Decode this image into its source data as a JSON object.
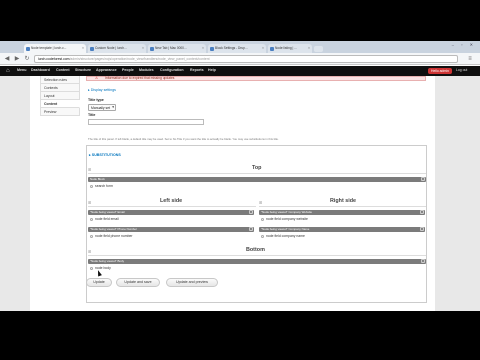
{
  "browser": {
    "tabs": [
      {
        "label": "Node template | lurch.c...",
        "active": true
      },
      {
        "label": "Custom Node | lurch...",
        "active": false
      },
      {
        "label": "New Tab | Mac 0000...",
        "active": false
      },
      {
        "label": "Block Settings - Drup...",
        "active": false
      },
      {
        "label": "Node listing | ...",
        "active": false
      }
    ],
    "window_controls": "– ▫ ✕",
    "back_icon": "back-arrow-icon",
    "forward_icon": "forward-arrow-icon",
    "reload_icon": "reload-icon",
    "url_host": "lurch.codeforest.com",
    "url_rest": "/admin/structure/pages/nojs/operation/node_view/handlers/node_view_panel_context/content"
  },
  "toolbar": {
    "items": [
      "Menu",
      "Dashboard",
      "Content",
      "Structure",
      "Appearance",
      "People",
      "Modules",
      "Configuration",
      "Reports",
      "Help"
    ],
    "user": "Hello admin",
    "logout": "Log out"
  },
  "sidebar": {
    "items": [
      {
        "label": "Selection rules",
        "active": false
      },
      {
        "label": "Contexts",
        "active": false
      },
      {
        "label": "Layout",
        "active": false
      },
      {
        "label": "Content",
        "active": true
      },
      {
        "label": "Preview",
        "active": false
      }
    ]
  },
  "messages": {
    "info": "Information due to expired that missing updates"
  },
  "form": {
    "display_settings_link": "▸ Display settings",
    "layout_label": "Title type",
    "layout_value": "Manually set",
    "title_label": "Title",
    "title_value": "",
    "help_text": "The title of this panel. If left blank, a default title may be used. Set to No Title if you want the title to actually be blank. You may use substitutions in this title.",
    "substitutions_link": "▸ SUBSTITUTIONS"
  },
  "regions": {
    "top": {
      "title": "Top",
      "panes": [
        {
          "bar": "Node Block",
          "items": [
            "search form"
          ]
        }
      ]
    },
    "left": {
      "title": "Left side",
      "panes": [
        {
          "bar": "\"Node being viewed\" Email",
          "items": [
            "node field email"
          ]
        },
        {
          "bar": "\"Node being viewed\" Phone Number",
          "items": [
            "node field phone number"
          ]
        }
      ]
    },
    "right": {
      "title": "Right side",
      "panes": [
        {
          "bar": "\"Node being viewed\" Company Website",
          "items": [
            "node field company website"
          ]
        },
        {
          "bar": "\"Node being viewed\" Company Name",
          "items": [
            "node field company name"
          ]
        }
      ]
    },
    "bottom": {
      "title": "Bottom",
      "panes": [
        {
          "bar": "\"Node being viewed\" Body",
          "items": [
            "node body"
          ]
        }
      ]
    }
  },
  "actions": {
    "update": "Update",
    "update_save": "Update and save",
    "update_preview": "Update and preview"
  }
}
